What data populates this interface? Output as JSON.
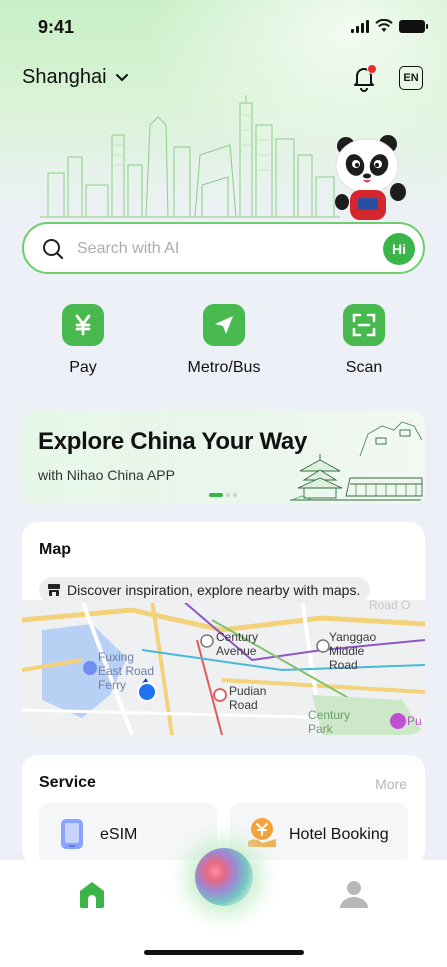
{
  "status_bar": {
    "time": "9:41"
  },
  "header": {
    "city": "Shanghai",
    "language_badge": "EN"
  },
  "search": {
    "placeholder": "Search with AI",
    "assistant_badge": "Hi"
  },
  "quick_actions": [
    {
      "label": "Pay",
      "icon": "yuan-icon"
    },
    {
      "label": "Metro/Bus",
      "icon": "send-arrow-icon"
    },
    {
      "label": "Scan",
      "icon": "scan-icon"
    }
  ],
  "banner": {
    "title": "Explore China Your Way",
    "subtitle": "with Nihao China APP"
  },
  "map_card": {
    "title": "Map",
    "tip": "Discover inspiration, explore nearby with maps.",
    "labels": {
      "fuxing": "Fuxing\nEast Road\nFerry",
      "century_avenue": "Century\nAvenue",
      "yanggao": "Yanggao\nMiddle\nRoad",
      "pudian": "Pudian\nRoad",
      "century_park": "Century\nPark",
      "road_o": "Road O",
      "pu": "Pu"
    }
  },
  "service_card": {
    "title": "Service",
    "more": "More",
    "items": [
      {
        "label": "eSIM",
        "icon": "phone-icon"
      },
      {
        "label": "Hotel Booking",
        "icon": "hotel-icon"
      }
    ]
  },
  "colors": {
    "brand_green": "#3bb54a",
    "notification_red": "#ee2a2a"
  }
}
